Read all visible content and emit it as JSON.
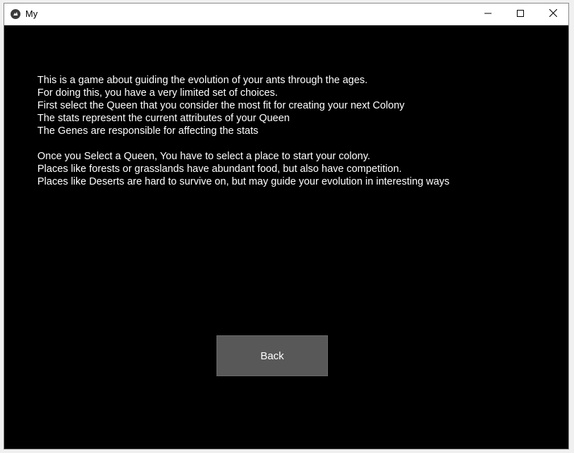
{
  "window": {
    "title": "My",
    "icon": "kivy-app-icon"
  },
  "titlebar_controls": {
    "minimize_icon": "minimize-icon",
    "maximize_icon": "maximize-icon",
    "close_icon": "close-icon"
  },
  "instructions": {
    "lines": [
      "This is a game about guiding the evolution of your ants through the ages.",
      "For doing this, you have a very limited set of choices.",
      "First select the Queen that you consider the most fit for creating your next Colony",
      "The stats represent the current attributes of your Queen",
      "The Genes are responsible for affecting the stats",
      "",
      "Once you Select a Queen, You have to select a place to start your colony.",
      "Places like forests or grasslands have abundant food, but also have competition.",
      "Places like Deserts are hard to survive on, but may guide your evolution in interesting ways"
    ]
  },
  "back_button": {
    "label": "Back"
  },
  "colors": {
    "background": "#000000",
    "text": "#ffffff",
    "button": "#585858",
    "titlebar": "#ffffff"
  }
}
